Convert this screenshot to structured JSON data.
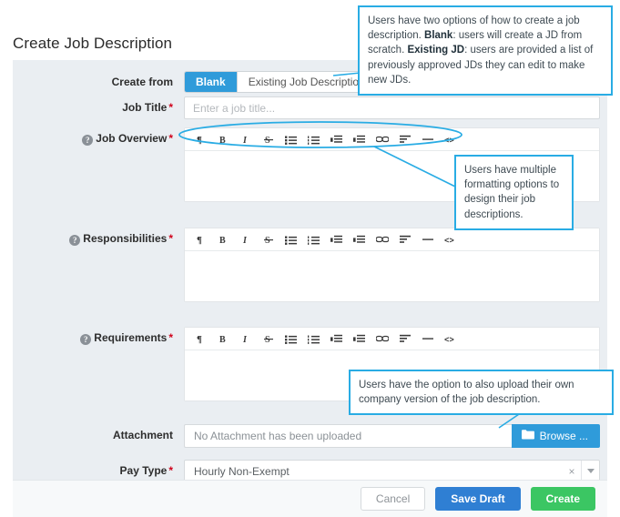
{
  "page": {
    "title": "Create Job Description"
  },
  "colors": {
    "accent_blue": "#2f9bda",
    "primary_blue": "#2f7fd3",
    "success_green": "#3bc663",
    "annotation_blue": "#29ace4",
    "panel_bg": "#eaeef2",
    "footer_bg": "#f7f9fa",
    "required_red": "#d0021b"
  },
  "form": {
    "create_from": {
      "label": "Create from",
      "options": [
        "Blank",
        "Existing Job Description"
      ],
      "selected": "Blank"
    },
    "job_title": {
      "label": "Job Title",
      "required": true,
      "value": "",
      "placeholder": "Enter a job title..."
    },
    "job_overview": {
      "label": "Job Overview",
      "required": true,
      "has_help": true,
      "value": ""
    },
    "responsibilities": {
      "label": "Responsibilities",
      "required": true,
      "has_help": true,
      "value": ""
    },
    "requirements": {
      "label": "Requirements",
      "required": true,
      "has_help": true,
      "value": ""
    },
    "attachment": {
      "label": "Attachment",
      "status_text": "No Attachment has been uploaded",
      "browse_label": "Browse ...",
      "browse_icon": "folder-icon"
    },
    "pay_type": {
      "label": "Pay Type",
      "required": true,
      "value": "Hourly Non-Exempt",
      "clear_icon": "close-icon",
      "arrow_icon": "chevron-down-icon"
    },
    "required_marker": "*",
    "help_marker": "?"
  },
  "editor_toolbar": {
    "buttons": [
      {
        "name": "paragraph-icon",
        "title": "Paragraph"
      },
      {
        "name": "bold-icon",
        "title": "Bold"
      },
      {
        "name": "italic-icon",
        "title": "Italic"
      },
      {
        "name": "strikethrough-icon",
        "title": "Strikethrough"
      },
      {
        "name": "unordered-list-icon",
        "title": "Bulleted list"
      },
      {
        "name": "ordered-list-icon",
        "title": "Numbered list"
      },
      {
        "name": "outdent-icon",
        "title": "Decrease indent"
      },
      {
        "name": "indent-icon",
        "title": "Increase indent"
      },
      {
        "name": "link-icon",
        "title": "Insert link"
      },
      {
        "name": "align-left-icon",
        "title": "Align"
      },
      {
        "name": "horizontal-rule-icon",
        "title": "Horizontal rule"
      },
      {
        "name": "code-icon",
        "title": "Code view"
      }
    ]
  },
  "footer": {
    "cancel_label": "Cancel",
    "save_draft_label": "Save Draft",
    "create_label": "Create"
  },
  "annotations": [
    {
      "id": "annotation-create-from",
      "text_parts": [
        {
          "t": "Users have two options of how to create a job description. ",
          "bold": false
        },
        {
          "t": "Blank",
          "bold": true
        },
        {
          "t": ": users will create a JD from scratch. ",
          "bold": false
        },
        {
          "t": "Existing JD",
          "bold": true
        },
        {
          "t": ": users are provided a list of previously approved JDs they can edit to make new JDs.",
          "bold": false
        }
      ],
      "plain": "Users have two options of how to create a job description. Blank: users will create a JD from scratch. Existing JD: users are provided a list of previously approved JDs they can edit to make new JDs."
    },
    {
      "id": "annotation-formatting",
      "plain": "Users have multiple formatting options to design their job descriptions."
    },
    {
      "id": "annotation-attachment",
      "plain": "Users have the option to also upload their own company version of the job description."
    }
  ]
}
